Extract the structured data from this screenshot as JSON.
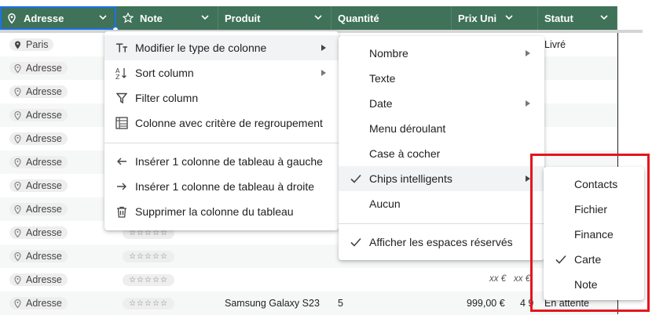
{
  "header": {
    "columns": [
      {
        "label": "Adresse",
        "icon": "location-pin-icon"
      },
      {
        "label": "Note",
        "icon": "star-outline-icon"
      },
      {
        "label": "Produit",
        "icon": ""
      },
      {
        "label": "Quantité",
        "icon": ""
      },
      {
        "label": "Prix Uni",
        "icon": ""
      },
      {
        "label": "Statut",
        "icon": ""
      }
    ]
  },
  "rows": {
    "first_chip": "Paris",
    "placeholder_chip": "Adresse",
    "stars_glyphs": "☆☆☆☆☆",
    "first_status": "Livré",
    "italic_price": "xx €",
    "italic_total": "xx €",
    "last_row": {
      "chip": "Adresse",
      "stars": "☆☆☆☆☆",
      "product": "Samsung Galaxy S23",
      "quantity": "5",
      "price": "999,00 €",
      "total": "4 9",
      "status": "En attente"
    }
  },
  "column_menu": {
    "items": [
      {
        "label": "Modifier le type de colonne",
        "icon": "text-type-icon"
      },
      {
        "label": "Sort column",
        "icon": "sort-az-icon"
      },
      {
        "label": "Filter column",
        "icon": "filter-icon"
      },
      {
        "label": "Colonne avec critère de regroupement",
        "icon": "group-table-icon"
      },
      {
        "label": "Insérer 1 colonne de tableau à gauche",
        "icon": "arrow-left-icon"
      },
      {
        "label": "Insérer 1 colonne de tableau à droite",
        "icon": "arrow-right-icon"
      },
      {
        "label": "Supprimer la colonne du tableau",
        "icon": "trash-icon"
      }
    ]
  },
  "type_menu": {
    "items": [
      {
        "label": "Nombre"
      },
      {
        "label": "Texte"
      },
      {
        "label": "Date"
      },
      {
        "label": "Menu déroulant"
      },
      {
        "label": "Case à cocher"
      },
      {
        "label": "Chips intelligents",
        "checked": true
      },
      {
        "label": "Aucun"
      },
      {
        "label": "Afficher les espaces réservés",
        "checked": true
      }
    ]
  },
  "chips_menu": {
    "items": [
      {
        "label": "Contacts"
      },
      {
        "label": "Fichier"
      },
      {
        "label": "Finance"
      },
      {
        "label": "Carte",
        "checked": true
      },
      {
        "label": "Note"
      }
    ]
  },
  "colors": {
    "header_bg": "#3f7258",
    "selection_blue": "#1a73e8",
    "highlight_red": "#e3161c"
  }
}
